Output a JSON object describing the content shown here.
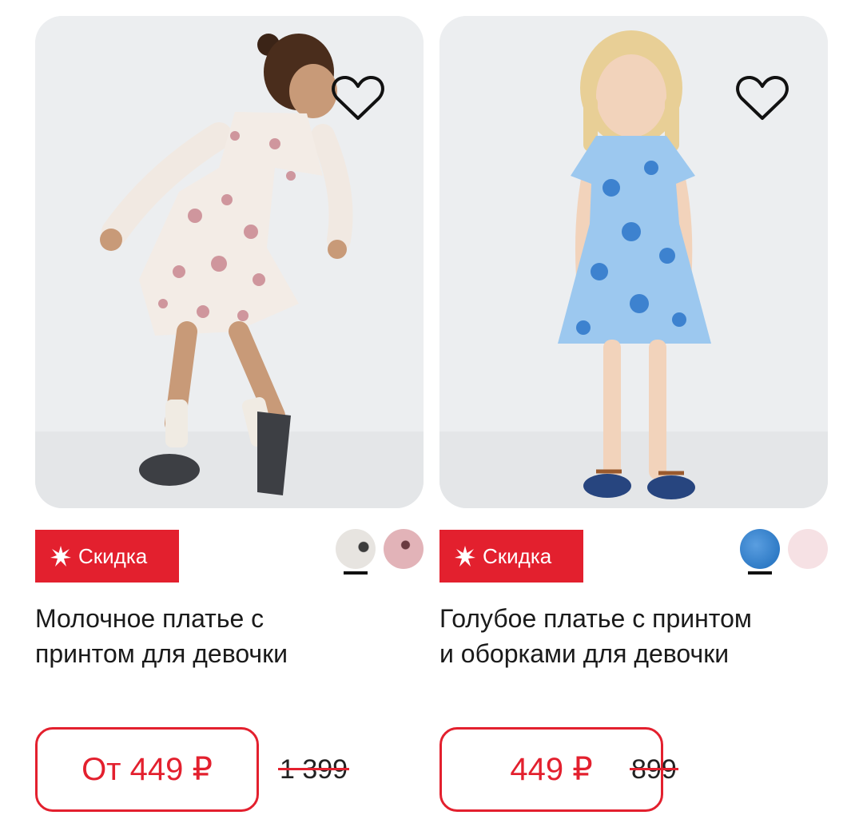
{
  "products": [
    {
      "badge": "Скидка",
      "title_line1": "Молочное платье с",
      "title_line2": "принтом для девочки",
      "price": "От 449 ₽",
      "old_price": "1 399",
      "swatches": [
        {
          "color": "#e7e4e0",
          "selected": true
        },
        {
          "color": "#e2b3b8",
          "selected": false
        }
      ],
      "dress_color": "#f3ece6",
      "print_color": "#c98891"
    },
    {
      "badge": "Скидка",
      "title_line1": "Голубое платье с принтом",
      "title_line2": "и оборками для девочки",
      "price": "449 ₽",
      "old_price": "899",
      "swatches": [
        {
          "color": "#2f7bc6",
          "selected": true
        },
        {
          "color": "#f6e1e4",
          "selected": false
        }
      ],
      "dress_color": "#9cc8ef",
      "print_color": "#3d82cf"
    }
  ],
  "colors": {
    "accent": "#e3202e",
    "text": "#1a1a1a",
    "photo_bg": "#eceef0"
  }
}
